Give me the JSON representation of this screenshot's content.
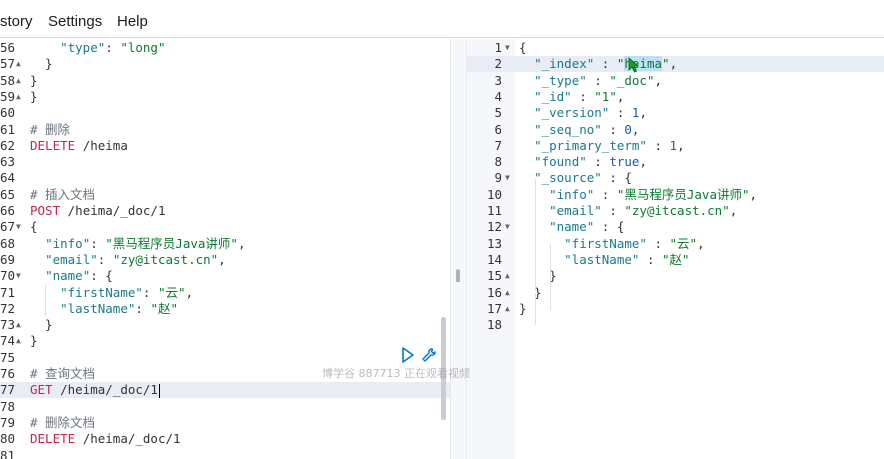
{
  "menubar": {
    "items": [
      "story",
      "Settings",
      "Help"
    ]
  },
  "request_editor": {
    "lines": [
      {
        "n": "56",
        "fold": "",
        "code": "    \"type\": \"long\""
      },
      {
        "n": "57",
        "fold": "▲",
        "code": "  }"
      },
      {
        "n": "58",
        "fold": "▲",
        "code": "}"
      },
      {
        "n": "59",
        "fold": "▲",
        "code": "}"
      },
      {
        "n": "60",
        "fold": "",
        "code": ""
      },
      {
        "n": "61",
        "fold": "",
        "code": "# 删除"
      },
      {
        "n": "62",
        "fold": "",
        "code": "DELETE /heima"
      },
      {
        "n": "63",
        "fold": "",
        "code": ""
      },
      {
        "n": "64",
        "fold": "",
        "code": ""
      },
      {
        "n": "65",
        "fold": "",
        "code": "# 插入文档"
      },
      {
        "n": "66",
        "fold": "",
        "code": "POST /heima/_doc/1"
      },
      {
        "n": "67",
        "fold": "▼",
        "code": "{"
      },
      {
        "n": "68",
        "fold": "",
        "code": "  \"info\": \"黑马程序员Java讲师\","
      },
      {
        "n": "69",
        "fold": "",
        "code": "  \"email\": \"zy@itcast.cn\","
      },
      {
        "n": "70",
        "fold": "▼",
        "code": "  \"name\": {"
      },
      {
        "n": "71",
        "fold": "",
        "code": "    \"firstName\": \"云\","
      },
      {
        "n": "72",
        "fold": "",
        "code": "    \"lastName\": \"赵\""
      },
      {
        "n": "73",
        "fold": "▲",
        "code": "  }"
      },
      {
        "n": "74",
        "fold": "▲",
        "code": "}"
      },
      {
        "n": "75",
        "fold": "",
        "code": ""
      },
      {
        "n": "76",
        "fold": "",
        "code": "# 查询文档"
      },
      {
        "n": "77",
        "fold": "",
        "code": "GET /heima/_doc/1"
      },
      {
        "n": "78",
        "fold": "",
        "code": ""
      },
      {
        "n": "79",
        "fold": "",
        "code": "# 删除文档"
      },
      {
        "n": "80",
        "fold": "",
        "code": "DELETE /heima/_doc/1"
      },
      {
        "n": "81",
        "fold": "",
        "code": ""
      }
    ]
  },
  "response_viewer": {
    "lines": [
      {
        "n": "1",
        "fold": "▼",
        "code": "{"
      },
      {
        "n": "2",
        "fold": "",
        "code": "  \"_index\" : \"heima\","
      },
      {
        "n": "3",
        "fold": "",
        "code": "  \"_type\" : \"_doc\","
      },
      {
        "n": "4",
        "fold": "",
        "code": "  \"_id\" : \"1\","
      },
      {
        "n": "5",
        "fold": "",
        "code": "  \"_version\" : 1,"
      },
      {
        "n": "6",
        "fold": "",
        "code": "  \"_seq_no\" : 0,"
      },
      {
        "n": "7",
        "fold": "",
        "code": "  \"_primary_term\" : 1,"
      },
      {
        "n": "8",
        "fold": "",
        "code": "  \"found\" : true,"
      },
      {
        "n": "9",
        "fold": "▼",
        "code": "  \"_source\" : {"
      },
      {
        "n": "10",
        "fold": "",
        "code": "    \"info\" : \"黑马程序员Java讲师\","
      },
      {
        "n": "11",
        "fold": "",
        "code": "    \"email\" : \"zy@itcast.cn\","
      },
      {
        "n": "12",
        "fold": "▼",
        "code": "    \"name\" : {"
      },
      {
        "n": "13",
        "fold": "",
        "code": "      \"firstName\" : \"云\","
      },
      {
        "n": "14",
        "fold": "",
        "code": "      \"lastName\" : \"赵\""
      },
      {
        "n": "15",
        "fold": "▲",
        "code": "    }"
      },
      {
        "n": "16",
        "fold": "▲",
        "code": "  }"
      },
      {
        "n": "17",
        "fold": "▲",
        "code": "}"
      },
      {
        "n": "18",
        "fold": "",
        "code": ""
      }
    ]
  },
  "actions": {
    "run_icon": "play-icon",
    "settings_icon": "wrench-icon"
  },
  "watermark": "博学谷 887713 正在观看视频",
  "colors": {
    "method": "#c7254e",
    "string": "#0c7a2e",
    "key": "#1a7a8c",
    "comment": "#6a7480",
    "active_line": "#e8edf5",
    "selection": "#bde0f5"
  }
}
